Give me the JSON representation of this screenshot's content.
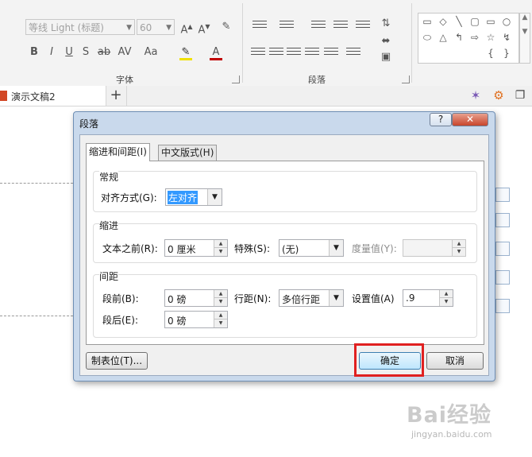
{
  "ribbon": {
    "font_name": "等线 Light (标题)",
    "font_size": "60",
    "group_font_label": "字体",
    "group_paragraph_label": "段落",
    "btn_bold": "B",
    "btn_italic": "I",
    "btn_underline": "U",
    "btn_shadow": "S",
    "btn_strike": "ab",
    "btn_spacing": "AV",
    "btn_case": "Aa",
    "btn_grow": "A",
    "btn_shrink": "A",
    "btn_color": "A",
    "shapes_glyphs": [
      "▭",
      "◇",
      "╲",
      "▢",
      "▭",
      "○",
      "⬭",
      "△",
      "↰",
      "⇨",
      "☆",
      "↯",
      "{",
      "}"
    ],
    "colors": {
      "accent": "#d24726",
      "highlight": "#e02020",
      "ok_button": "#bee6fd"
    }
  },
  "tabs": {
    "document_title": "演示文稿2",
    "add_tab": "+"
  },
  "dialog": {
    "title": "段落",
    "help_button": "?",
    "close_button": "✕",
    "tab_indent_spacing": "缩进和间距(I)",
    "tab_chinese_layout": "中文版式(H)",
    "general": {
      "title": "常规",
      "alignment_label": "对齐方式(G):",
      "alignment_value": "左对齐"
    },
    "indent": {
      "title": "缩进",
      "before_text_label": "文本之前(R):",
      "before_text_value": "0 厘米",
      "special_label": "特殊(S):",
      "special_value": "(无)",
      "measure_label": "度量值(Y):",
      "measure_value": ""
    },
    "spacing": {
      "title": "间距",
      "before_label": "段前(B):",
      "before_value": "0 磅",
      "after_label": "段后(E):",
      "after_value": "0 磅",
      "line_spacing_label": "行距(N):",
      "line_spacing_value": "多倍行距",
      "set_value_label": "设置值(A)",
      "set_value": ".9"
    },
    "tabs_button": "制表位(T)...",
    "ok_button": "确定",
    "cancel_button": "取消"
  },
  "watermark": {
    "brand": "Bai经验",
    "url": "jingyan.baidu.com"
  }
}
